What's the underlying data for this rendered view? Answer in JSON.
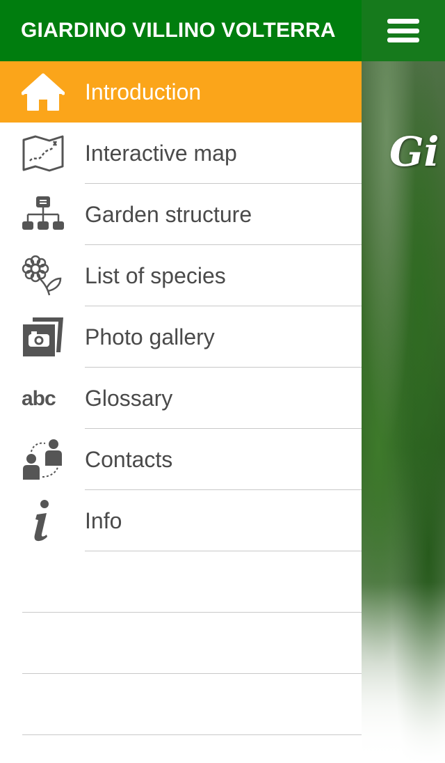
{
  "app": {
    "title": "GIARDINO VILLINO VOLTERRA"
  },
  "colors": {
    "header_green": "#007d0e",
    "active_orange": "#fba51a",
    "text_gray": "#4a4a4a",
    "icon_gray": "#555555"
  },
  "menu": {
    "items": [
      {
        "label": "Introduction",
        "icon": "home-icon",
        "active": true
      },
      {
        "label": "Interactive map",
        "icon": "map-icon",
        "active": false
      },
      {
        "label": "Garden structure",
        "icon": "hierarchy-icon",
        "active": false
      },
      {
        "label": "List of species",
        "icon": "flower-icon",
        "active": false
      },
      {
        "label": "Photo gallery",
        "icon": "camera-icon",
        "active": false
      },
      {
        "label": "Glossary",
        "icon": "abc-icon",
        "active": false
      },
      {
        "label": "Contacts",
        "icon": "people-icon",
        "active": false
      },
      {
        "label": "Info",
        "icon": "info-icon",
        "active": false
      }
    ]
  },
  "main": {
    "menu_button_icon": "hamburger-icon",
    "photo_title": "Gi"
  }
}
